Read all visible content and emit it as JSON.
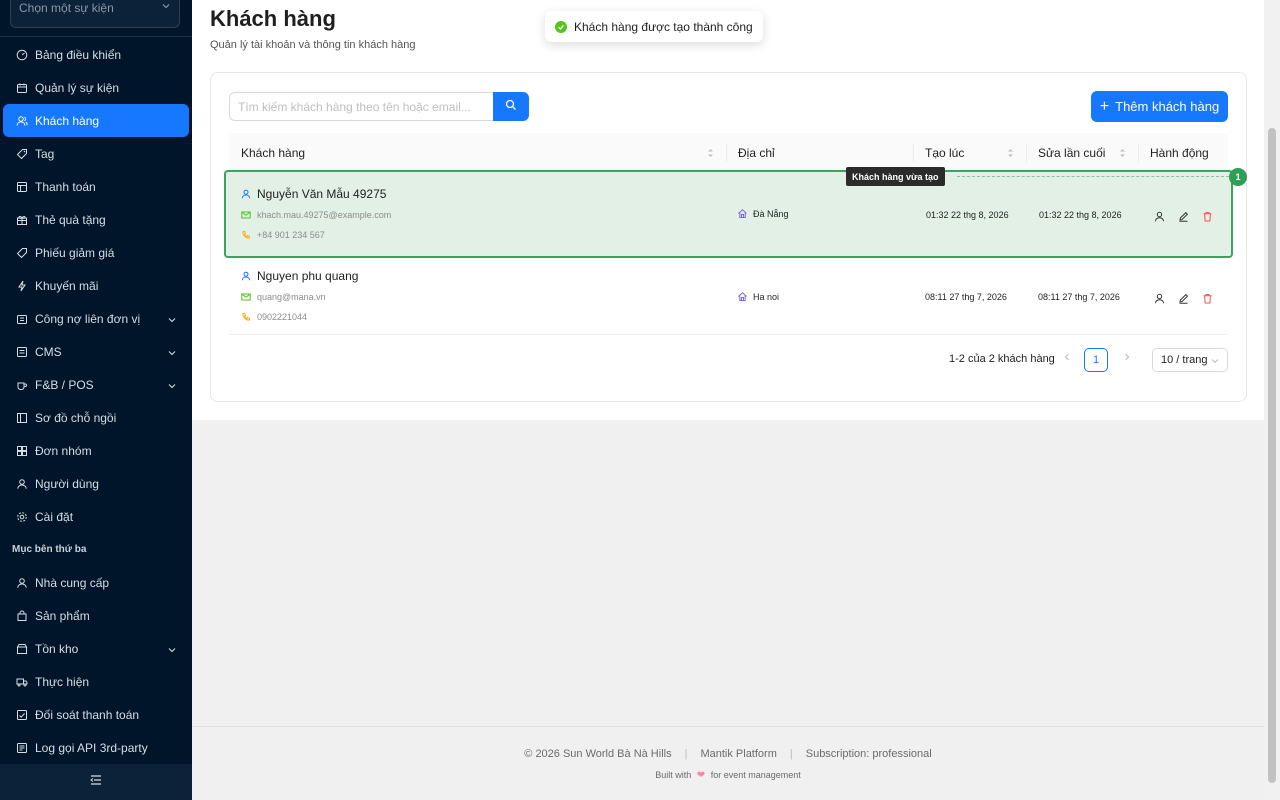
{
  "sidebar": {
    "event_select_placeholder": "Chọn một sự kiện",
    "items": [
      {
        "label": "Bảng điều khiển",
        "icon": "dashboard-icon"
      },
      {
        "label": "Quản lý sự kiện",
        "icon": "calendar-icon"
      },
      {
        "label": "Khách hàng",
        "icon": "users-icon",
        "active": true
      },
      {
        "label": "Tag",
        "icon": "tag-icon"
      },
      {
        "label": "Thanh toán",
        "icon": "payment-icon"
      },
      {
        "label": "Thẻ quà tặng",
        "icon": "gift-icon"
      },
      {
        "label": "Phiếu giảm giá",
        "icon": "coupon-icon"
      },
      {
        "label": "Khuyến mãi",
        "icon": "promotion-icon"
      },
      {
        "label": "Công nợ liên đơn vị",
        "icon": "debt-icon",
        "expandable": true
      },
      {
        "label": "CMS",
        "icon": "cms-icon",
        "expandable": true
      },
      {
        "label": "F&B / POS",
        "icon": "coffee-icon",
        "expandable": true
      },
      {
        "label": "Sơ đồ chỗ ngồi",
        "icon": "seat-map-icon"
      },
      {
        "label": "Đơn nhóm",
        "icon": "group-order-icon"
      },
      {
        "label": "Người dùng",
        "icon": "user-icon"
      },
      {
        "label": "Cài đặt",
        "icon": "settings-icon"
      }
    ],
    "section_label": "Mục bên thứ ba",
    "third_party": [
      {
        "label": "Nhà cung cấp",
        "icon": "supplier-icon"
      },
      {
        "label": "Sản phẩm",
        "icon": "product-icon"
      },
      {
        "label": "Tồn kho",
        "icon": "inventory-icon",
        "expandable": true
      },
      {
        "label": "Thực hiện",
        "icon": "fulfillment-icon"
      },
      {
        "label": "Đối soát thanh toán",
        "icon": "reconcile-icon"
      },
      {
        "label": "Log gọi API 3rd-party",
        "icon": "log-icon"
      }
    ]
  },
  "header": {
    "title": "Khách hàng",
    "subtitle": "Quản lý tài khoản và thông tin khách hàng"
  },
  "toast": {
    "message": "Khách hàng được tạo thành công"
  },
  "search": {
    "placeholder": "Tìm kiếm khách hàng theo tên hoặc email..."
  },
  "add_button": {
    "label": "Thêm khách hàng"
  },
  "table": {
    "columns": [
      "Khách hàng",
      "Địa chỉ",
      "Tạo lúc",
      "Sửa lần cuối",
      "Hành động"
    ],
    "rows": [
      {
        "name": "Nguyễn Văn Mẫu 49275",
        "email": "khach.mau.49275@example.com",
        "phone": "+84 901 234 567",
        "address": "Đà Nẵng",
        "created": "01:32 22 thg 8, 2026",
        "updated": "01:32 22 thg 8, 2026"
      },
      {
        "name": "Nguyen phu quang",
        "email": "quang@mana.vn",
        "phone": "0902221044",
        "address": "Ha noi",
        "created": "08:11 27 thg 7, 2026",
        "updated": "08:11 27 thg 7, 2026"
      }
    ]
  },
  "highlight": {
    "tooltip": "Khách hàng vừa tạo",
    "badge": "1"
  },
  "pagination": {
    "total_text": "1-2 của 2 khách hàng",
    "current_page": "1",
    "page_size": "10 / trang"
  },
  "footer": {
    "copyright": "© 2026 Sun World Bà Nà Hills",
    "platform": "Mantik Platform",
    "subscription": "Subscription: professional",
    "built_prefix": "Built with",
    "built_suffix": "for event management"
  },
  "colors": {
    "primary": "#1677ff",
    "sidebar_bg": "#001529",
    "highlight_border": "#3aa35f",
    "success": "#52c41a",
    "danger": "#ff4d4f"
  }
}
